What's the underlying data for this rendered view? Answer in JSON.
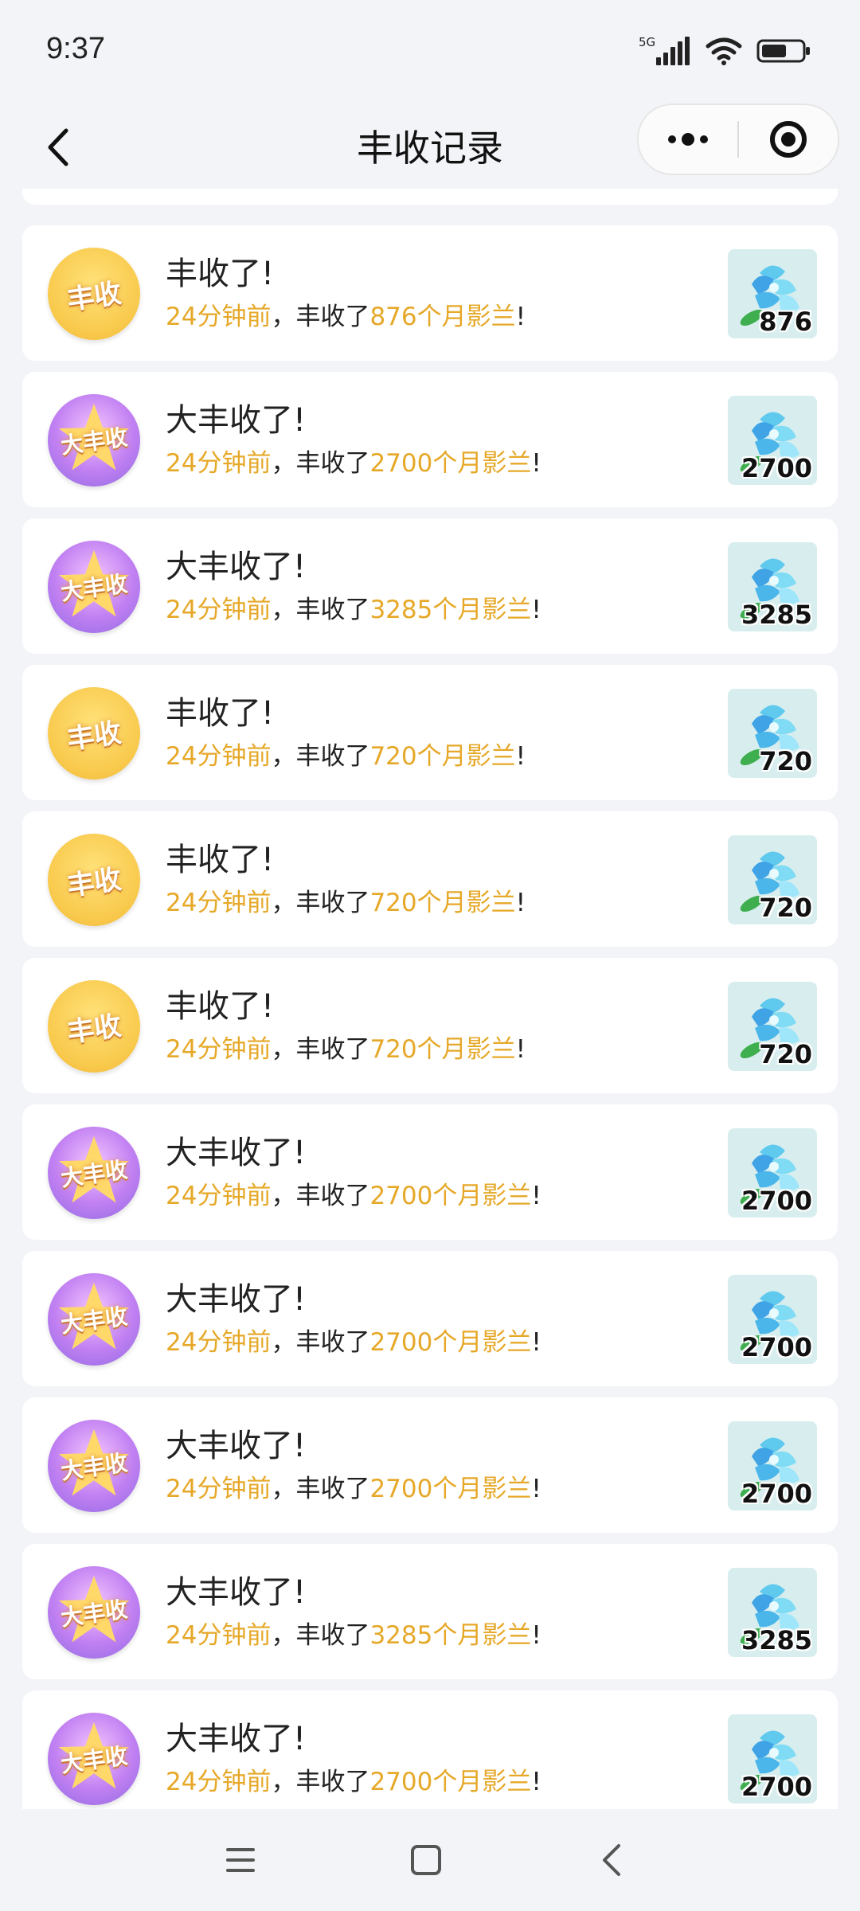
{
  "status_bar": {
    "time": "9:37",
    "network": "5G"
  },
  "header": {
    "title": "丰收记录"
  },
  "records": [
    {
      "badge_type": "gold",
      "badge_text": "丰收",
      "title": "丰收了!",
      "time_ago": "24分钟前",
      "mid_text": "，丰收了",
      "amount_text": "876个月影兰",
      "end_text": "!",
      "qty": "876"
    },
    {
      "badge_type": "purple",
      "badge_text": "大丰收",
      "title": "大丰收了!",
      "time_ago": "24分钟前",
      "mid_text": "，丰收了",
      "amount_text": "2700个月影兰",
      "end_text": "!",
      "qty": "2700"
    },
    {
      "badge_type": "purple",
      "badge_text": "大丰收",
      "title": "大丰收了!",
      "time_ago": "24分钟前",
      "mid_text": "，丰收了",
      "amount_text": "3285个月影兰",
      "end_text": "!",
      "qty": "3285"
    },
    {
      "badge_type": "gold",
      "badge_text": "丰收",
      "title": "丰收了!",
      "time_ago": "24分钟前",
      "mid_text": "，丰收了",
      "amount_text": "720个月影兰",
      "end_text": "!",
      "qty": "720"
    },
    {
      "badge_type": "gold",
      "badge_text": "丰收",
      "title": "丰收了!",
      "time_ago": "24分钟前",
      "mid_text": "，丰收了",
      "amount_text": "720个月影兰",
      "end_text": "!",
      "qty": "720"
    },
    {
      "badge_type": "gold",
      "badge_text": "丰收",
      "title": "丰收了!",
      "time_ago": "24分钟前",
      "mid_text": "，丰收了",
      "amount_text": "720个月影兰",
      "end_text": "!",
      "qty": "720"
    },
    {
      "badge_type": "purple",
      "badge_text": "大丰收",
      "title": "大丰收了!",
      "time_ago": "24分钟前",
      "mid_text": "，丰收了",
      "amount_text": "2700个月影兰",
      "end_text": "!",
      "qty": "2700"
    },
    {
      "badge_type": "purple",
      "badge_text": "大丰收",
      "title": "大丰收了!",
      "time_ago": "24分钟前",
      "mid_text": "，丰收了",
      "amount_text": "2700个月影兰",
      "end_text": "!",
      "qty": "2700"
    },
    {
      "badge_type": "purple",
      "badge_text": "大丰收",
      "title": "大丰收了!",
      "time_ago": "24分钟前",
      "mid_text": "，丰收了",
      "amount_text": "2700个月影兰",
      "end_text": "!",
      "qty": "2700"
    },
    {
      "badge_type": "purple",
      "badge_text": "大丰收",
      "title": "大丰收了!",
      "time_ago": "24分钟前",
      "mid_text": "，丰收了",
      "amount_text": "3285个月影兰",
      "end_text": "!",
      "qty": "3285"
    },
    {
      "badge_type": "purple",
      "badge_text": "大丰收",
      "title": "大丰收了!",
      "time_ago": "24分钟前",
      "mid_text": "，丰收了",
      "amount_text": "2700个月影兰",
      "end_text": "!",
      "qty": "2700"
    }
  ],
  "colors": {
    "highlight": "#e6a828",
    "page_bg": "#f3f4f8",
    "card_bg": "#ffffff"
  },
  "icons": {
    "back": "chevron-left-icon",
    "more": "more-dots-icon",
    "close": "target-circle-icon",
    "item": "moon-orchid-icon",
    "sys_menu": "menu-lines-icon",
    "sys_home": "square-home-icon",
    "sys_back": "triangle-back-icon"
  }
}
